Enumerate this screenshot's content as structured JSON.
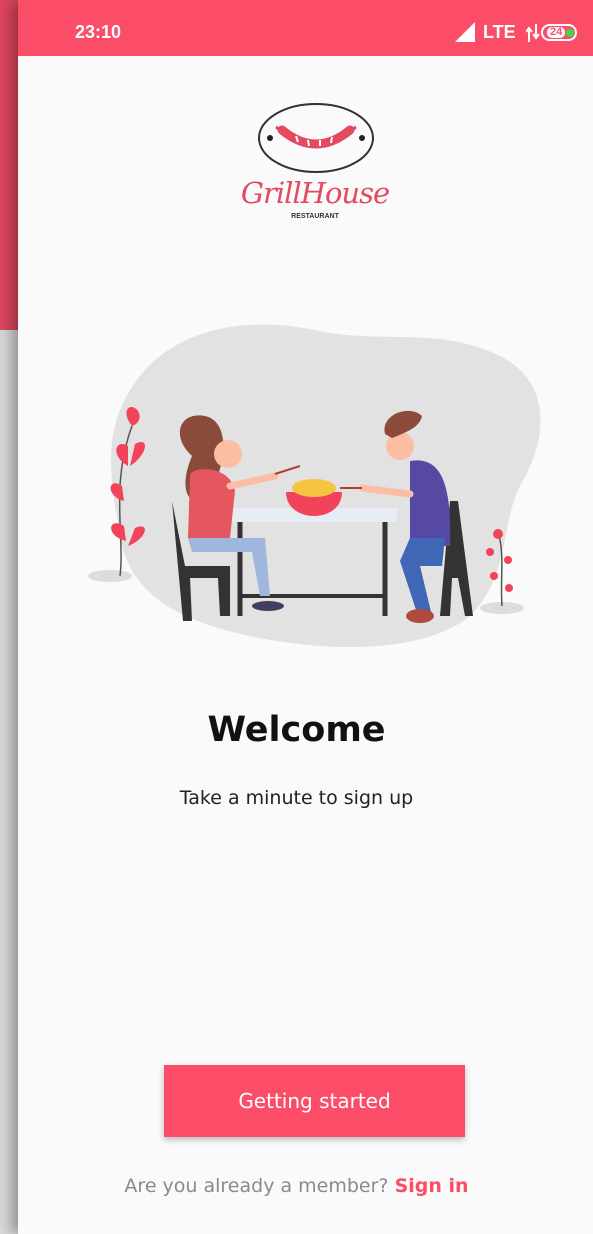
{
  "colors": {
    "accent": "#fb4d67",
    "brand": "#e34a60",
    "battery_indicator": "#3ddc3d",
    "background": "#fafafa"
  },
  "status_bar": {
    "time": "23:10",
    "network": "LTE",
    "battery_level": "24",
    "icons": [
      "signal-icon",
      "data-transfer-icon",
      "battery-icon"
    ]
  },
  "brand": {
    "name": "GrillHouse",
    "subtitle": "RESTAURANT",
    "logo_icon": "grill-sausage-logo"
  },
  "illustration": {
    "icon": "couple-dining-illustration"
  },
  "welcome": {
    "title": "Welcome",
    "subtitle": "Take a minute to sign up"
  },
  "actions": {
    "primary_button_label": "Getting started",
    "member_prompt": "Are you already a member?",
    "sign_in_label": "Sign in"
  }
}
